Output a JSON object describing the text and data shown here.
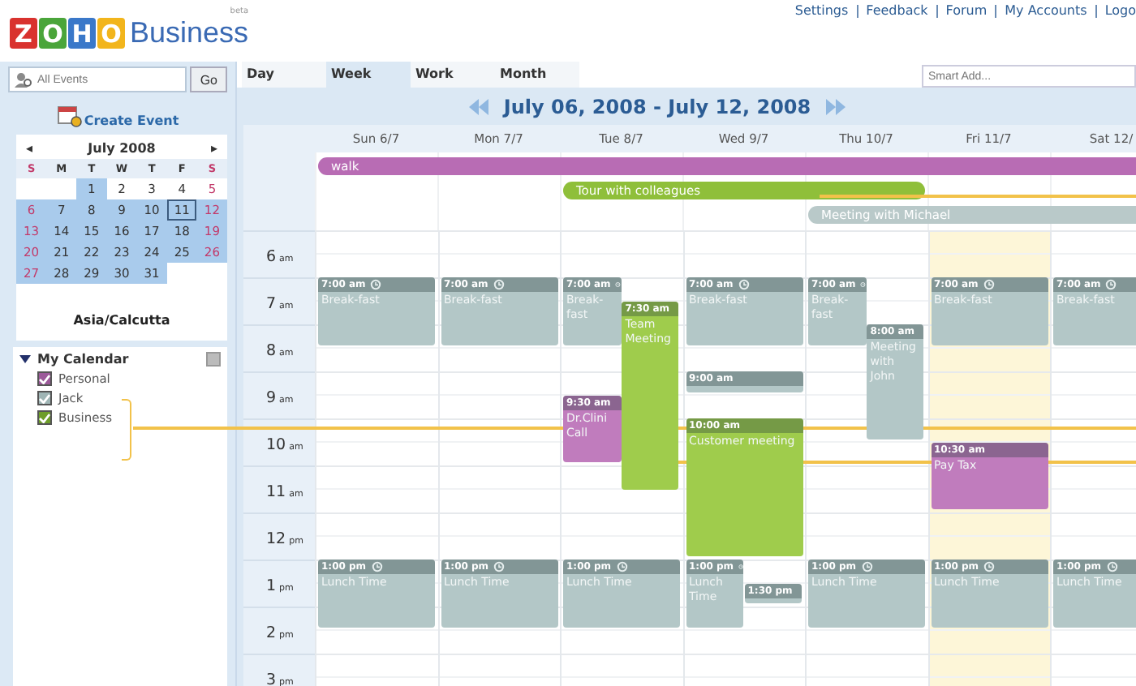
{
  "logo": {
    "letters": [
      "Z",
      "O",
      "H",
      "O"
    ],
    "word": "Business",
    "tag": "beta"
  },
  "top_links": [
    "Settings",
    "Feedback",
    "Forum",
    "My Accounts",
    "Logo"
  ],
  "search": {
    "placeholder": "All Events",
    "button": "Go"
  },
  "create_event": "Create Event",
  "mini_calendar": {
    "month": "July 2008",
    "prev": "◂",
    "next": "▸",
    "weekdays": [
      "S",
      "M",
      "T",
      "W",
      "T",
      "F",
      "S"
    ],
    "weeks": [
      [
        {
          "d": "1",
          "shaded": true,
          "today": false
        },
        {
          "d": "2",
          "shaded": false,
          "today": false
        },
        {
          "d": "3",
          "shaded": false,
          "today": false
        },
        {
          "d": "4",
          "shaded": false,
          "today": false
        },
        {
          "d": "5",
          "shaded": false,
          "today": false
        }
      ],
      [
        {
          "d": "6",
          "shaded": true,
          "today": false
        },
        {
          "d": "7",
          "shaded": true,
          "today": false
        },
        {
          "d": "8",
          "shaded": true,
          "today": false
        },
        {
          "d": "9",
          "shaded": true,
          "today": false
        },
        {
          "d": "10",
          "shaded": true,
          "today": false
        },
        {
          "d": "11",
          "shaded": true,
          "today": true
        },
        {
          "d": "12",
          "shaded": true,
          "today": false
        }
      ],
      [
        {
          "d": "13",
          "shaded": true,
          "today": false
        },
        {
          "d": "14",
          "shaded": true,
          "today": false
        },
        {
          "d": "15",
          "shaded": true,
          "today": false
        },
        {
          "d": "16",
          "shaded": true,
          "today": false
        },
        {
          "d": "17",
          "shaded": true,
          "today": false
        },
        {
          "d": "18",
          "shaded": true,
          "today": false
        },
        {
          "d": "19",
          "shaded": true,
          "today": false
        }
      ],
      [
        {
          "d": "20",
          "shaded": true,
          "today": false
        },
        {
          "d": "21",
          "shaded": true,
          "today": false
        },
        {
          "d": "22",
          "shaded": true,
          "today": false
        },
        {
          "d": "23",
          "shaded": true,
          "today": false
        },
        {
          "d": "24",
          "shaded": true,
          "today": false
        },
        {
          "d": "25",
          "shaded": true,
          "today": false
        },
        {
          "d": "26",
          "shaded": true,
          "today": false
        }
      ],
      [
        {
          "d": "27",
          "shaded": true,
          "today": false
        },
        {
          "d": "28",
          "shaded": true,
          "today": false
        },
        {
          "d": "29",
          "shaded": true,
          "today": false
        },
        {
          "d": "30",
          "shaded": true,
          "today": false
        },
        {
          "d": "31",
          "shaded": true,
          "today": false
        }
      ]
    ]
  },
  "timezone": "Asia/Calcutta",
  "calendars": {
    "title": "My Calendar",
    "expanded": true,
    "items": [
      {
        "label": "Personal",
        "checked": true,
        "color": "#9c5a9a"
      },
      {
        "label": "Jack",
        "checked": true,
        "color": "#9fb5b5"
      },
      {
        "label": "Business",
        "checked": true,
        "color": "#6e9e2a"
      }
    ]
  },
  "tabs": [
    {
      "label": "Day",
      "selected": false
    },
    {
      "label": "Week",
      "selected": true
    },
    {
      "label": "Work",
      "selected": false
    },
    {
      "label": "Month",
      "selected": false
    }
  ],
  "smart_add": {
    "placeholder": "Smart Add..."
  },
  "range_title": "July 06, 2008 - July 12, 2008",
  "all_day": [
    {
      "title": "walk",
      "color": "#b86cb4"
    },
    {
      "title": "Tour with colleagues",
      "color": "#8fbf3a"
    },
    {
      "title": "Meeting with Michael",
      "color": "#b9c9c9"
    }
  ],
  "hours": [
    {
      "hour": "6",
      "suffix": "am"
    },
    {
      "hour": "7",
      "suffix": "am"
    },
    {
      "hour": "8",
      "suffix": "am"
    },
    {
      "hour": "9",
      "suffix": "am"
    },
    {
      "hour": "10",
      "suffix": "am"
    },
    {
      "hour": "11",
      "suffix": "am"
    },
    {
      "hour": "12",
      "suffix": "pm"
    },
    {
      "hour": "1",
      "suffix": "pm"
    },
    {
      "hour": "2",
      "suffix": "pm"
    },
    {
      "hour": "3",
      "suffix": "pm"
    }
  ],
  "days": [
    {
      "label": "Sun 6/7",
      "today": false,
      "events": [
        {
          "time": "7:00 am",
          "title": "Break-fast",
          "color": "#b3c7c7",
          "recurring": true
        },
        {
          "time": "1:00 pm",
          "title": "Lunch Time",
          "color": "#b3c7c7",
          "recurring": true
        }
      ]
    },
    {
      "label": "Mon 7/7",
      "today": false,
      "events": [
        {
          "time": "7:00 am",
          "title": "Break-fast",
          "color": "#b3c7c7",
          "recurring": true
        },
        {
          "time": "1:00 pm",
          "title": "Lunch Time",
          "color": "#b3c7c7",
          "recurring": true
        }
      ]
    },
    {
      "label": "Tue 8/7",
      "today": false,
      "events": [
        {
          "time": "7:00 am",
          "title": "Break-fast",
          "color": "#b3c7c7",
          "recurring": true
        },
        {
          "time": "7:30 am",
          "title": "Team Meeting",
          "color": "#9fcc4c",
          "recurring": false
        },
        {
          "time": "9:30 am",
          "title": "Dr.Clini Call",
          "color": "#c07cbd",
          "recurring": false
        },
        {
          "time": "1:00 pm",
          "title": "Lunch Time",
          "color": "#b3c7c7",
          "recurring": true
        }
      ]
    },
    {
      "label": "Wed 9/7",
      "today": false,
      "events": [
        {
          "time": "7:00 am",
          "title": "Break-fast",
          "color": "#b3c7c7",
          "recurring": true
        },
        {
          "time": "9:00 am",
          "color": "#b3c7c7",
          "recurring": false
        },
        {
          "time": "10:00 am",
          "title": "Customer meeting",
          "color": "#9fcc4c",
          "recurring": false
        },
        {
          "time": "1:00 pm",
          "title": "Lunch Time",
          "color": "#b3c7c7",
          "recurring": true
        },
        {
          "time": "1:30 pm",
          "color": "#b3c7c7",
          "recurring": false
        }
      ]
    },
    {
      "label": "Thu 10/7",
      "today": false,
      "events": [
        {
          "time": "7:00 am",
          "title": "Break-fast",
          "color": "#b3c7c7",
          "recurring": true
        },
        {
          "time": "8:00 am",
          "title": "Meeting with John",
          "color": "#b3c7c7",
          "recurring": false
        },
        {
          "time": "1:00 pm",
          "title": "Lunch Time",
          "color": "#b3c7c7",
          "recurring": true
        }
      ]
    },
    {
      "label": "Fri 11/7",
      "today": true,
      "events": [
        {
          "time": "7:00 am",
          "title": "Break-fast",
          "color": "#b3c7c7",
          "recurring": true
        },
        {
          "time": "10:30 am",
          "title": "Pay Tax",
          "color": "#c07cbd",
          "recurring": false
        },
        {
          "time": "1:00 pm",
          "title": "Lunch Time",
          "color": "#b3c7c7",
          "recurring": true
        }
      ]
    },
    {
      "label": "Sat 12/",
      "today": false,
      "events": [
        {
          "time": "7:00 am",
          "title": "Break-fast",
          "color": "#b3c7c7",
          "recurring": true
        },
        {
          "time": "1:00 pm",
          "title": "Lunch Time",
          "color": "#b3c7c7",
          "recurring": true
        }
      ]
    }
  ]
}
